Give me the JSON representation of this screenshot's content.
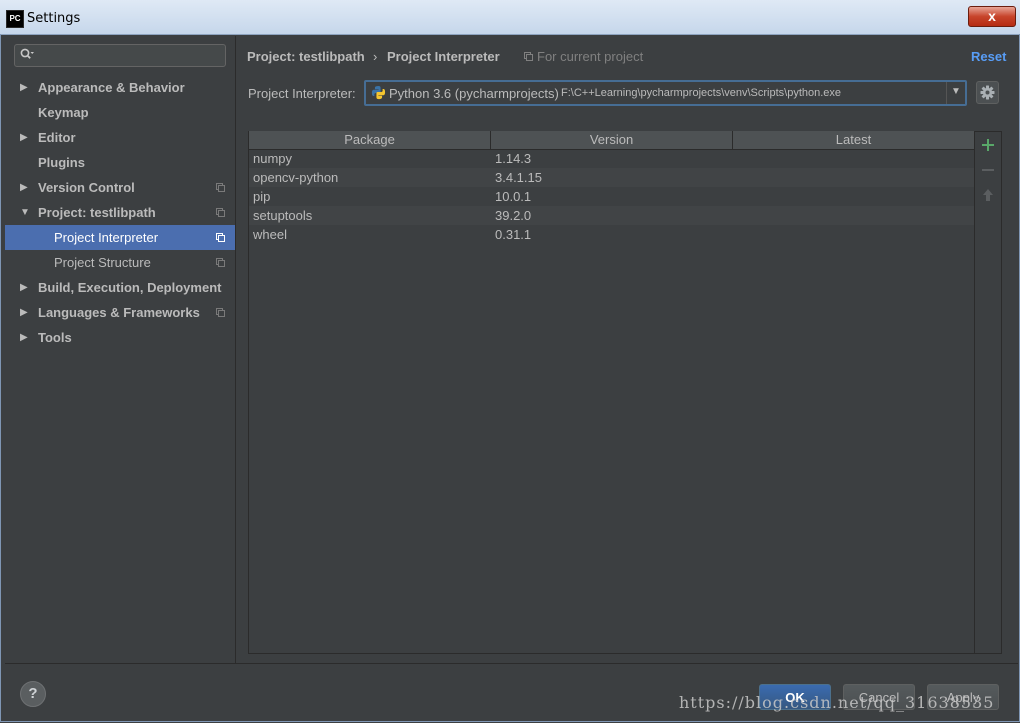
{
  "window": {
    "title": "Settings",
    "app_logo": "PC",
    "close_label": "x"
  },
  "sidebar": {
    "search": {
      "value": "",
      "placeholder": ""
    },
    "items": [
      {
        "label": "Appearance & Behavior",
        "arrow": "right",
        "copy_icon": false
      },
      {
        "label": "Keymap",
        "arrow": "",
        "copy_icon": false
      },
      {
        "label": "Editor",
        "arrow": "right",
        "copy_icon": false
      },
      {
        "label": "Plugins",
        "arrow": "",
        "copy_icon": false
      },
      {
        "label": "Version Control",
        "arrow": "right",
        "copy_icon": true
      },
      {
        "label": "Project: testlibpath",
        "arrow": "down",
        "copy_icon": true
      },
      {
        "label": "Project Interpreter",
        "arrow": "",
        "copy_icon": true,
        "selected": true,
        "sub": true
      },
      {
        "label": "Project Structure",
        "arrow": "",
        "copy_icon": true,
        "sub": true
      },
      {
        "label": "Build, Execution, Deployment",
        "arrow": "right",
        "copy_icon": false
      },
      {
        "label": "Languages & Frameworks",
        "arrow": "right",
        "copy_icon": true
      },
      {
        "label": "Tools",
        "arrow": "right",
        "copy_icon": false
      }
    ]
  },
  "header": {
    "breadcrumb_parent": "Project: testlibpath",
    "breadcrumb_separator": "›",
    "breadcrumb_current": "Project Interpreter",
    "scope_label": "For current project",
    "reset_label": "Reset"
  },
  "interpreter": {
    "label": "Project Interpreter:",
    "name": "Python 3.6 (pycharmprojects)",
    "path": "F:\\C++Learning\\pycharmprojects\\venv\\Scripts\\python.exe"
  },
  "packages": {
    "columns": [
      "Package",
      "Version",
      "Latest"
    ],
    "rows": [
      {
        "package": "numpy",
        "version": "1.14.3",
        "latest": ""
      },
      {
        "package": "opencv-python",
        "version": "3.4.1.15",
        "latest": ""
      },
      {
        "package": "pip",
        "version": "10.0.1",
        "latest": ""
      },
      {
        "package": "setuptools",
        "version": "39.2.0",
        "latest": ""
      },
      {
        "package": "wheel",
        "version": "0.31.1",
        "latest": ""
      }
    ]
  },
  "footer": {
    "help_label": "?",
    "ok_label": "OK",
    "cancel_label": "Cancel",
    "apply_label": "Apply",
    "watermark": "https://blog.csdn.net/qq_31638535"
  },
  "colors": {
    "selection": "#4b6eaf",
    "reset_link": "#589df6",
    "add_icon": "#59a869",
    "background": "#3c3f41"
  }
}
